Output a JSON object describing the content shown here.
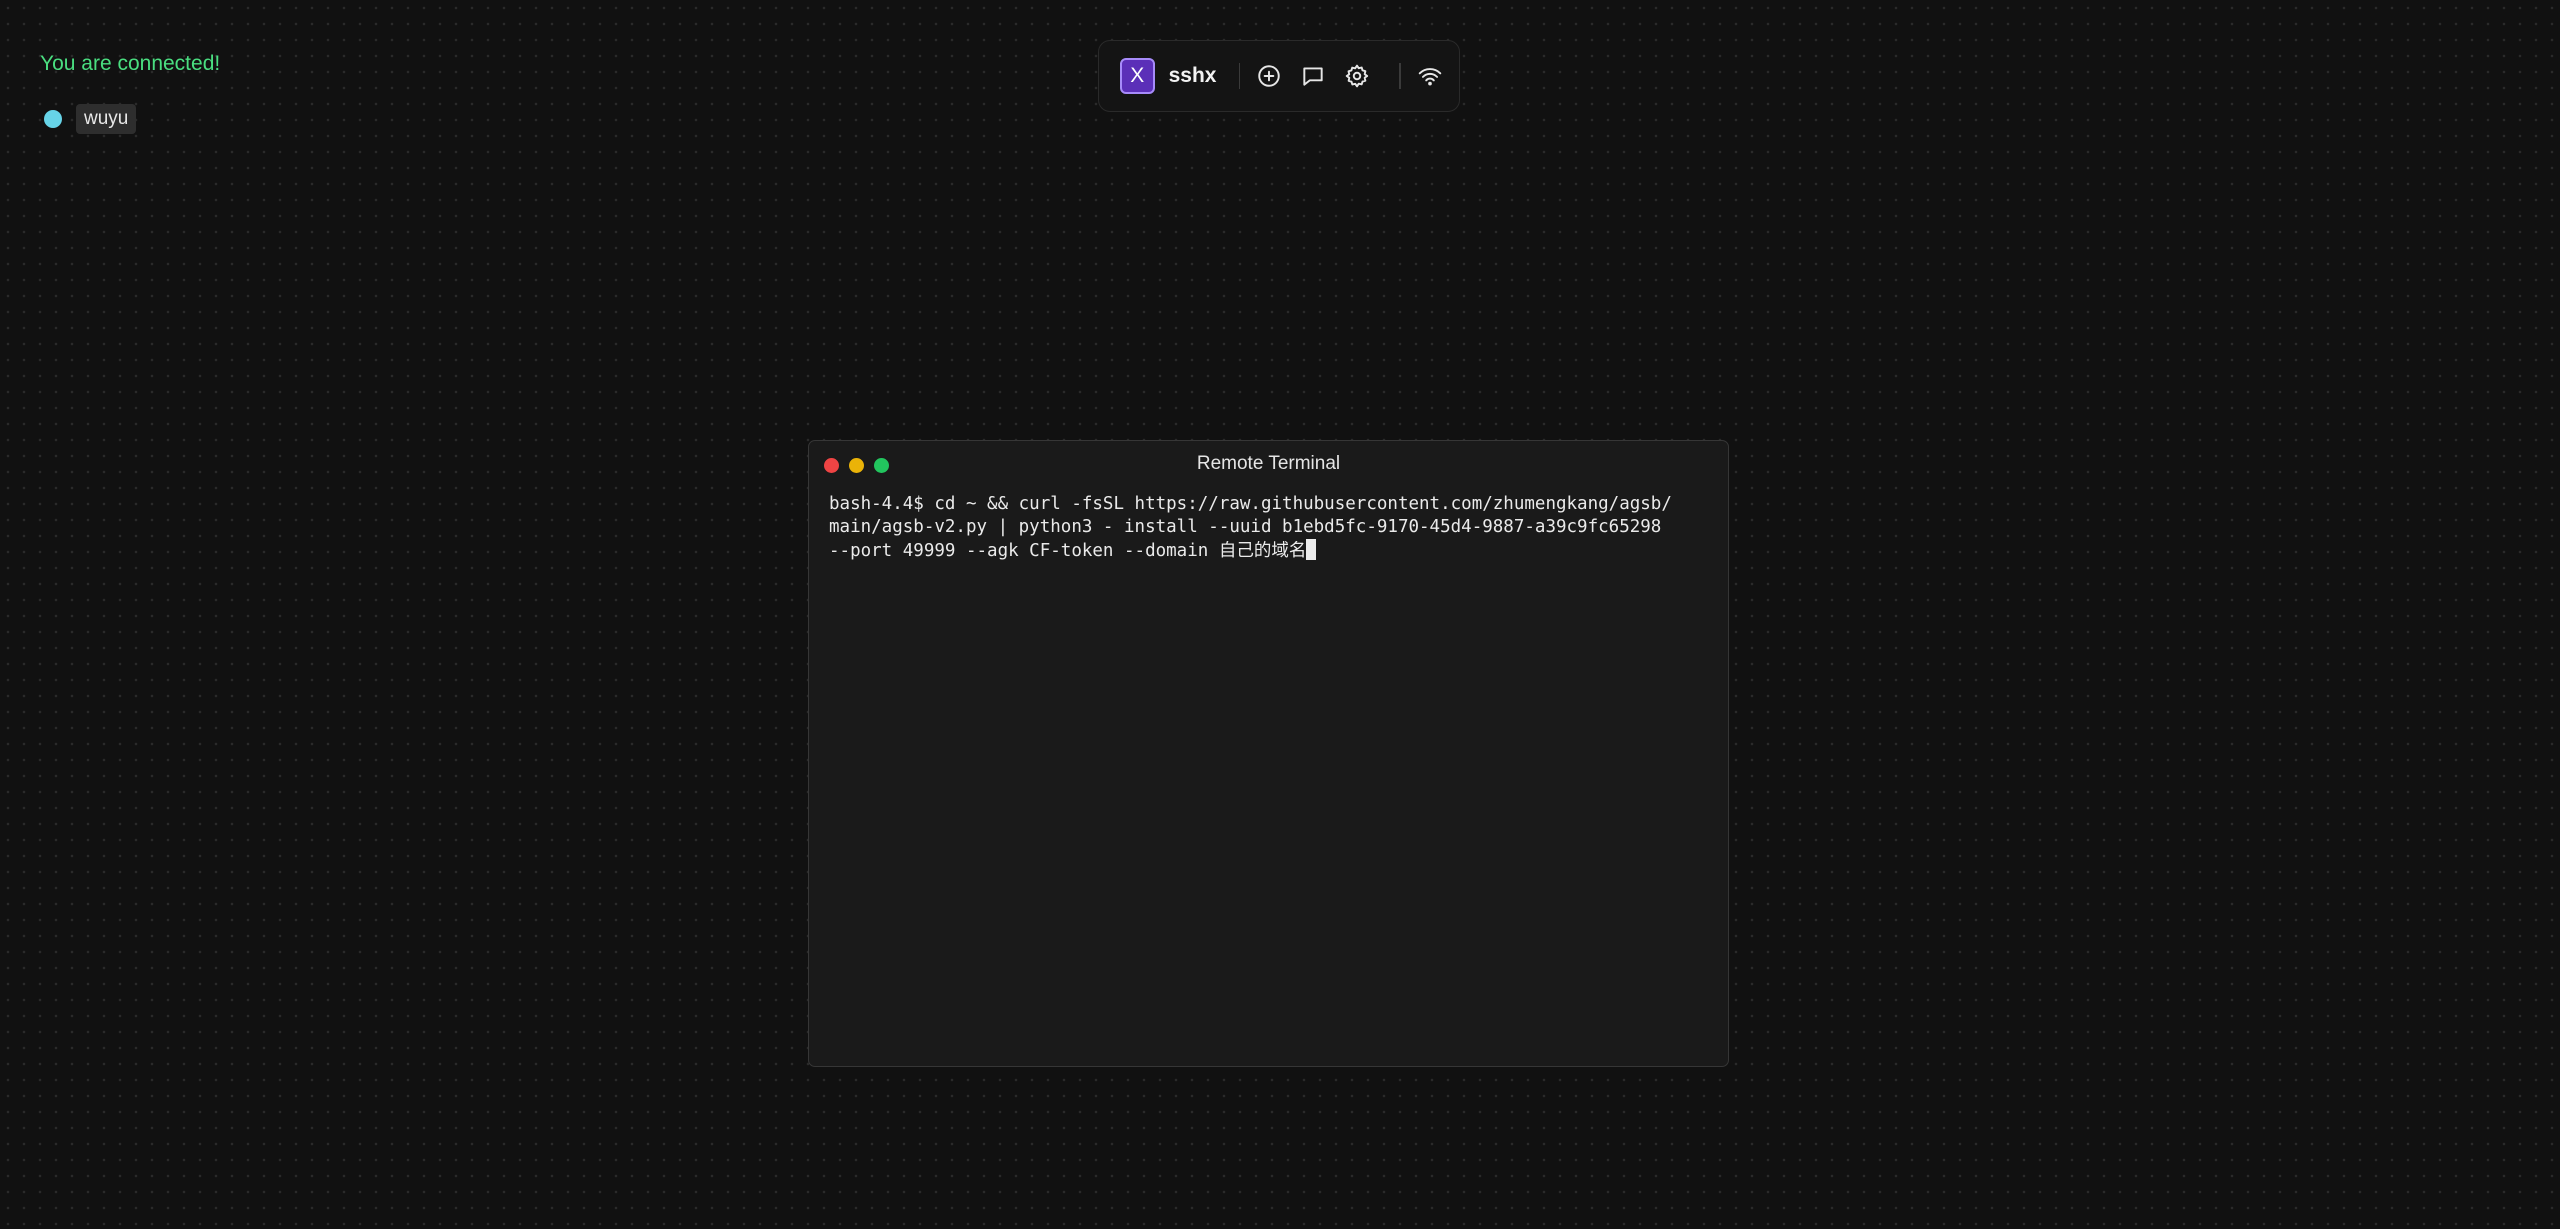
{
  "status": {
    "text": "You are connected!",
    "color": "#4ade80"
  },
  "users": [
    {
      "name": "wuyu",
      "color": "#67d4e8"
    }
  ],
  "toolbar": {
    "logo_letter": "X",
    "app_name": "sshx",
    "buttons": [
      {
        "icon": "plus-circle-icon",
        "label": "New terminal"
      },
      {
        "icon": "chat-icon",
        "label": "Chat"
      },
      {
        "icon": "gear-icon",
        "label": "Settings"
      },
      {
        "icon": "wifi-icon",
        "label": "Network"
      }
    ],
    "accent_color": "#5b2fb8"
  },
  "terminal": {
    "title": "Remote Terminal",
    "lines": [
      "bash-4.4$ cd ~ && curl -fsSL https://raw.githubusercontent.com/zhumengkang/agsb/",
      "main/agsb-v2.py | python3 - install --uuid b1ebd5fc-9170-45d4-9887-a39c9fc65298",
      "--port 49999 --agk CF-token --domain 自己的域名"
    ]
  }
}
